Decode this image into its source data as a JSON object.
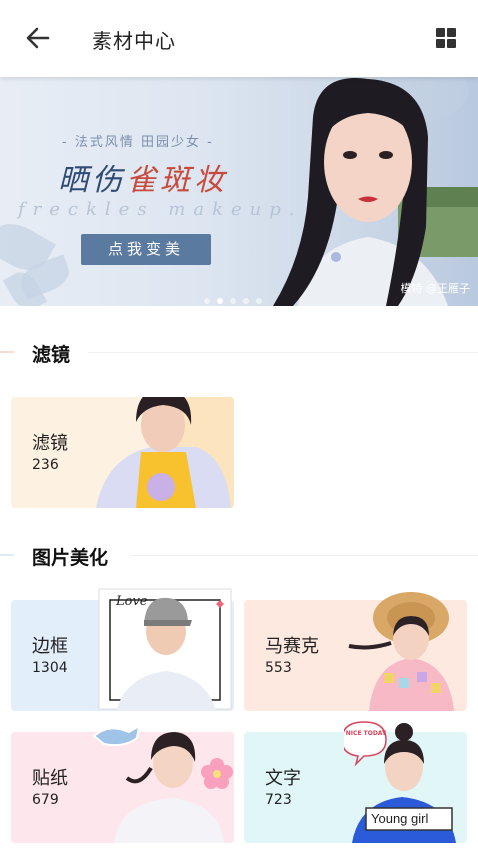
{
  "header": {
    "title": "素材中心",
    "back_icon": "arrow-left-icon",
    "layout_icon": "grid-icon"
  },
  "banner": {
    "subtitle": "- 法式风情  田园少女 -",
    "title_part1": "晒伤",
    "title_part2": "雀斑妆",
    "script_text": "freckles makeup.",
    "cta": "点我变美",
    "credit": "模特 @王雁子",
    "slide_count": 5,
    "active_slide": 2
  },
  "sections": [
    {
      "label": "滤镜",
      "accent": "#f8dccb",
      "cards": [
        {
          "name": "滤镜",
          "count": "236",
          "bg": "#fdf1e2"
        }
      ]
    },
    {
      "label": "图片美化",
      "accent": "#dcecf8",
      "cards": [
        {
          "name": "边框",
          "count": "1304",
          "bg": "#e3eefb"
        },
        {
          "name": "马赛克",
          "count": "553",
          "bg": "#fde9df"
        },
        {
          "name": "贴纸",
          "count": "679",
          "bg": "#fde6ec"
        },
        {
          "name": "文字",
          "count": "723",
          "bg": "#e0f6f7"
        }
      ]
    }
  ],
  "decorations": {
    "frame_text": "Love",
    "sticker_text": "NICE TODAY",
    "bubble_text": "Young girl"
  }
}
